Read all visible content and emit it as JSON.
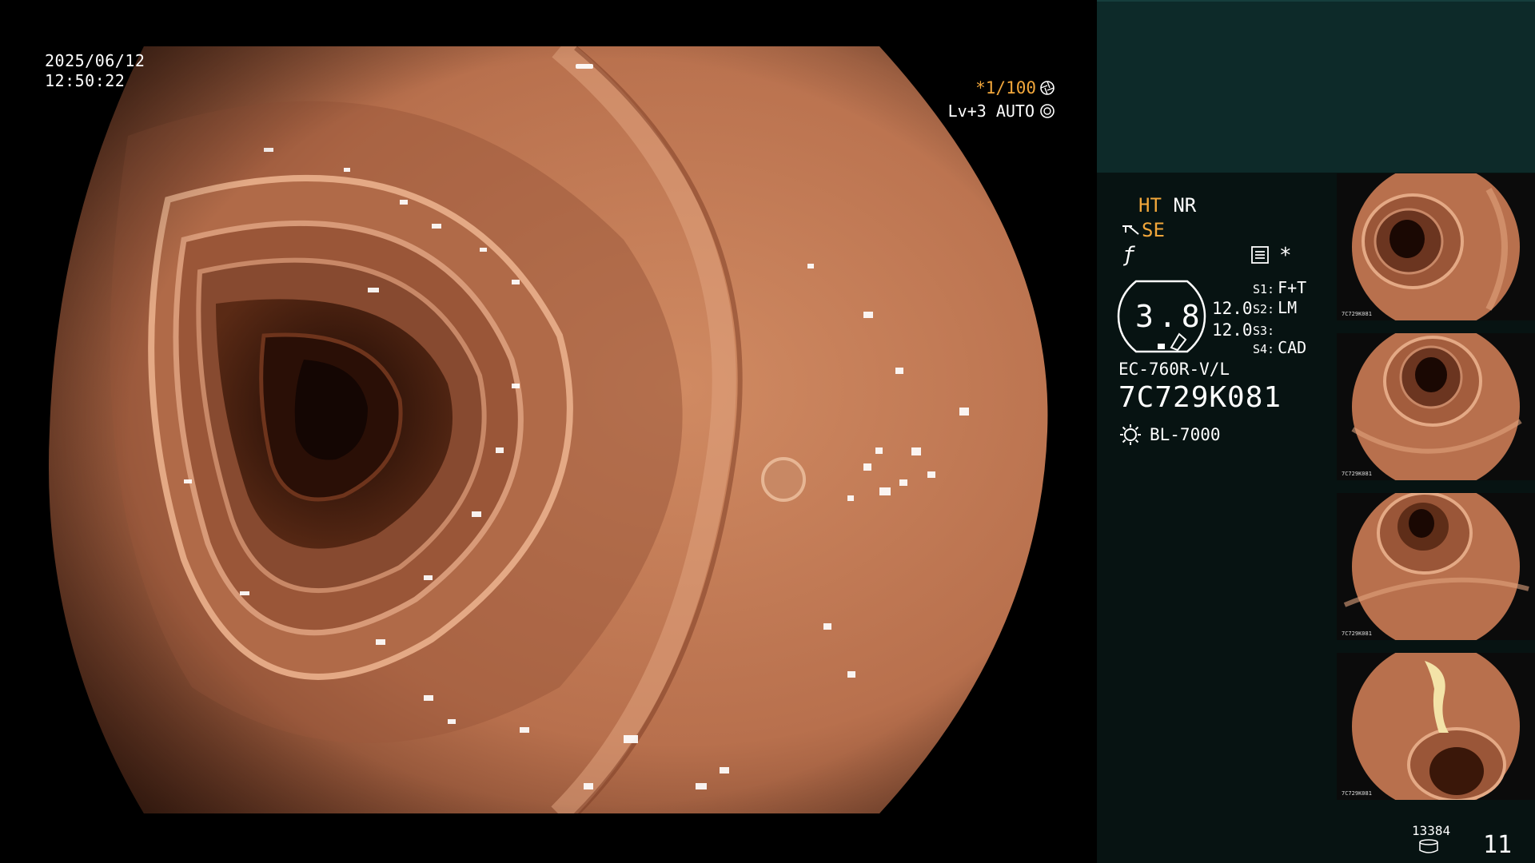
{
  "osd": {
    "date": "2025/06/12",
    "time": "12:50:22",
    "shutter": "*1/100",
    "shutter_icon": "shutter-icon",
    "level": "Lv+3 AUTO",
    "level_icon": "auto-iris-icon"
  },
  "panel": {
    "ht": "HT",
    "nr": "NR",
    "se": "SE",
    "se_icon": "structure-enhance-icon",
    "f_icon": "f-symbol-icon",
    "menu_icon": "settings-list-icon",
    "asterisk": "*",
    "zoom_value": "3.8",
    "value_a": "12.0",
    "value_b": "12.0",
    "slots": [
      {
        "label": "S1:",
        "value": "F+T"
      },
      {
        "label": "S2:",
        "value": "LM"
      },
      {
        "label": "S3:",
        "value": ""
      },
      {
        "label": "S4:",
        "value": "CAD"
      }
    ],
    "scope_model": "EC-760R-V/L",
    "scope_serial": "7C729K081",
    "light_source": "BL-7000",
    "light_icon": "light-source-icon"
  },
  "thumbnails": [
    {
      "caption": "7C729K081"
    },
    {
      "caption": "7C729K081"
    },
    {
      "caption": "7C729K081"
    },
    {
      "caption": "7C729K081"
    }
  ],
  "counters": {
    "image_count": "13384",
    "storage_icon": "storage-icon",
    "index": "11"
  },
  "colors": {
    "accent_orange": "#f2a73b",
    "panel_top": "#0d2a29",
    "panel_body": "#071312",
    "tissue": "#b8704d",
    "lumen": "#2a0f06"
  }
}
